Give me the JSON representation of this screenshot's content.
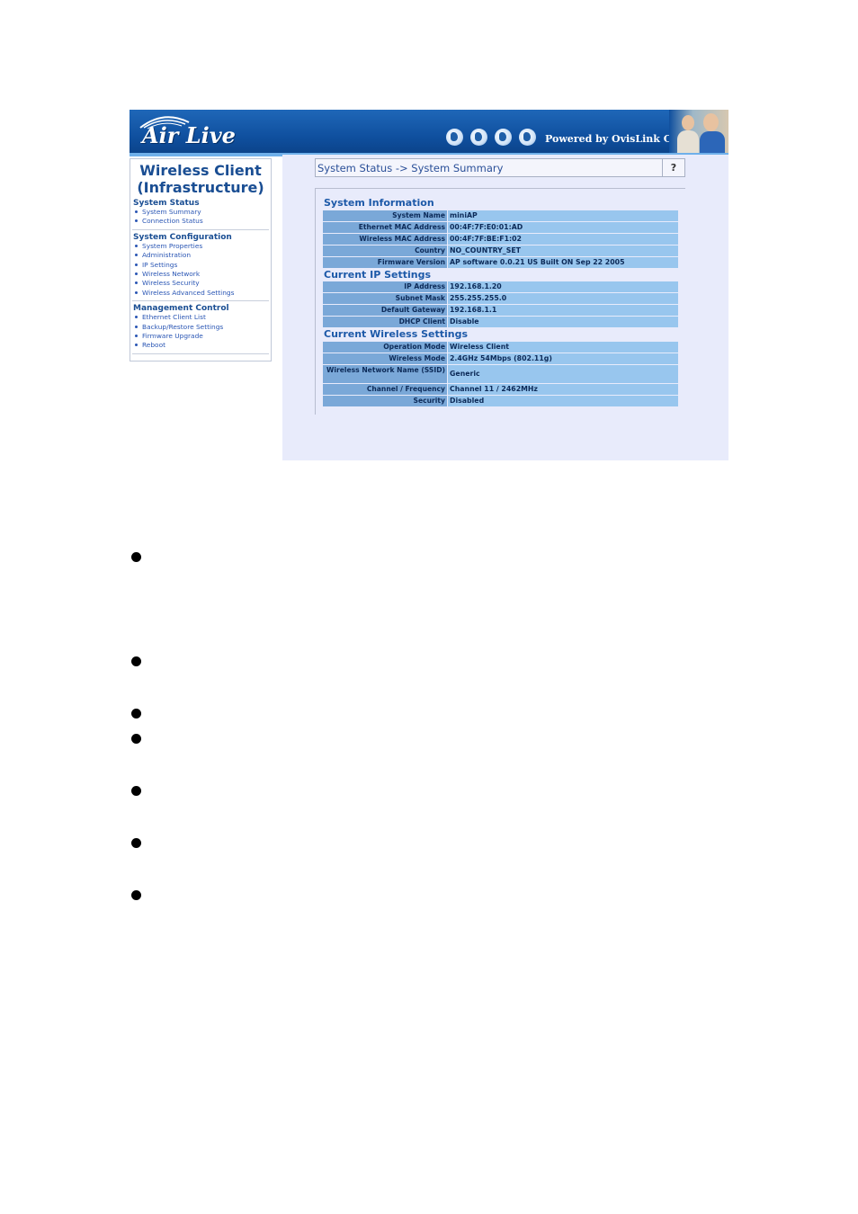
{
  "header": {
    "logo_text": "Air Live",
    "powered_by": "Powered by OvisLink Corp."
  },
  "sidebar": {
    "title_line1": "Wireless Client",
    "title_line2": "(Infrastructure)",
    "sections": [
      {
        "title": "System Status",
        "items": [
          "System Summary",
          "Connection Status"
        ]
      },
      {
        "title": "System Configuration",
        "items": [
          "System Properties",
          "Administration",
          "IP Settings",
          "Wireless Network",
          "Wireless Security",
          "Wireless Advanced Settings"
        ]
      },
      {
        "title": "Management Control",
        "items": [
          "Ethernet Client List",
          "Backup/Restore Settings",
          "Firmware Upgrade",
          "Reboot"
        ]
      }
    ]
  },
  "main": {
    "breadcrumb": "System Status -> System Summary",
    "help_label": "?",
    "groups": [
      {
        "title": "System Information",
        "rows": [
          {
            "label": "System Name",
            "value": "miniAP"
          },
          {
            "label": "Ethernet MAC Address",
            "value": "00:4F:7F:E0:01:AD"
          },
          {
            "label": "Wireless MAC Address",
            "value": "00:4F:7F:BE:F1:02"
          },
          {
            "label": "Country",
            "value": "NO_COUNTRY_SET"
          },
          {
            "label": "Firmware Version",
            "value": "AP software 0.0.21 US Built ON Sep 22 2005"
          }
        ]
      },
      {
        "title": "Current IP Settings",
        "rows": [
          {
            "label": "IP Address",
            "value": "192.168.1.20"
          },
          {
            "label": "Subnet Mask",
            "value": "255.255.255.0"
          },
          {
            "label": "Default Gateway",
            "value": "192.168.1.1"
          },
          {
            "label": "DHCP Client",
            "value": "Disable"
          }
        ]
      },
      {
        "title": "Current Wireless Settings",
        "rows": [
          {
            "label": "Operation Mode",
            "value": "Wireless Client"
          },
          {
            "label": "Wireless Mode",
            "value": "2.4GHz 54Mbps (802.11g)"
          },
          {
            "label": "Wireless Network Name (SSID)",
            "value": "Generic"
          },
          {
            "label": "Channel / Frequency",
            "value": "Channel 11 / 2462MHz"
          },
          {
            "label": "Security",
            "value": "Disabled"
          }
        ]
      }
    ]
  }
}
